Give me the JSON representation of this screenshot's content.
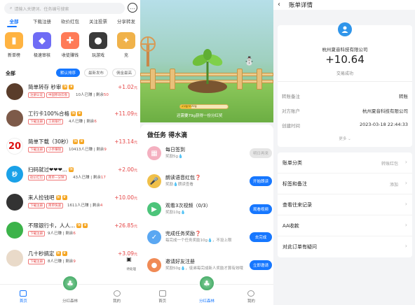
{
  "home": {
    "search_placeholder": "请输入关键词、任务编号搜索",
    "tabs": [
      "全部",
      "下载注册",
      "砍价红包",
      "关注投票",
      "分享转发"
    ],
    "categories": [
      {
        "label": "新单榜",
        "icon": "bars-icon",
        "color": "#ffb341"
      },
      {
        "label": "极速审核",
        "icon": "shield-icon",
        "color": "#6f6cf5"
      },
      {
        "label": "收徒赚钱",
        "icon": "gift-icon",
        "color": "#ff7b57"
      },
      {
        "label": "玩游戏",
        "icon": "gamepad-icon",
        "color": "#3a3a3a"
      },
      {
        "label": "充",
        "icon": "windmill-icon",
        "color": "#f0b24a"
      }
    ],
    "section_title": "全部",
    "sort": [
      "默认排序",
      "最新发布",
      "佣金最高"
    ],
    "tasks": [
      {
        "title": "简单转存 秒审",
        "tags": [
          "注册认证",
          "中国移动云盘"
        ],
        "done": "10人已赚",
        "left": "50",
        "price": "+1.02",
        "avatar_bg": "#5a3d2b",
        "avatar_text": ""
      },
      {
        "title": "工行卡100%合格",
        "tags": [
          "下载注册",
          "工商银行"
        ],
        "done": "4人已赚",
        "left": "6",
        "price": "+11.09",
        "avatar_bg": "#7d5a49",
        "avatar_text": ""
      },
      {
        "title": "简单下载（30秒）",
        "tags": [
          "下载注册",
          "小手赚钱"
        ],
        "done": "10413人已赚",
        "left": "9",
        "price": "+13.14",
        "avatar_bg": "#fff",
        "avatar_text": "20"
      },
      {
        "title": "扫码就过❤❤❤...",
        "tags": [
          "砍价红包",
          "简单一分钟"
        ],
        "done": "43人已赚",
        "left": "17",
        "price": "+2.00",
        "avatar_bg": "#1aa1e8",
        "avatar_text": "秒"
      },
      {
        "title": "来人捡钱吧",
        "tags": [
          "下载注册",
          "简单快速"
        ],
        "done": "1611人已赚",
        "left": "4",
        "price": "+10.00",
        "avatar_bg": "#333",
        "avatar_text": ""
      },
      {
        "title": "不限银行卡，人人...",
        "tags": [
          "下载注册"
        ],
        "done": "9人已赚",
        "left": "6",
        "price": "+26.85",
        "avatar_bg": "#3cb34a",
        "avatar_text": ""
      },
      {
        "title": "几十秒搞定",
        "tags": [
          "下载注册"
        ],
        "done": "8人已赚",
        "left": "9",
        "price": "+3.09",
        "avatar_bg": "#e9dac9",
        "avatar_text": ""
      }
    ],
    "publish_label": "待处理",
    "nav": [
      "首页",
      "分红森林",
      "我的"
    ]
  },
  "garden": {
    "progress_text": "23g/100g",
    "progress_fraction": 0.23,
    "tip": "还需要79g获得一份分红奖",
    "title": "做任务 得水滴",
    "tasks": [
      {
        "name": "每日签到",
        "desc": "奖励5g💧",
        "button": "明日再来",
        "enabled": false,
        "color": "#f4b0c0",
        "icon": "▦"
      },
      {
        "name": "朗读语音红包❓",
        "desc": "奖励💧朗读查看",
        "button": "开始朗读",
        "enabled": true,
        "color": "#f0c04a",
        "icon": "🎤"
      },
      {
        "name": "观看3次视频（0/3）",
        "desc": "奖励10g💧",
        "button": "观看视频",
        "enabled": true,
        "color": "#4cc47a",
        "icon": "▶"
      },
      {
        "name": "完成任务奖励❓",
        "desc": "每完成一个任务奖励10g💧，不设上限",
        "button": "去完成",
        "enabled": true,
        "color": "#5aa7f2",
        "icon": "✓"
      },
      {
        "name": "邀请好友注册",
        "desc": "奖励50g💧，徒弟每完成新人奖励才算有效哦",
        "button": "立即邀请",
        "enabled": true,
        "color": "#f08a55",
        "icon": "●"
      }
    ],
    "nav": [
      "首页",
      "分红森林",
      "我的"
    ]
  },
  "bill": {
    "title": "账单详情",
    "company": "杭州夏音科技有限公司",
    "amount": "+10.64",
    "status": "交易成功",
    "rows": [
      {
        "k": "转账备注",
        "v": "转账"
      },
      {
        "k": "对方账户",
        "v": "杭州夏音科技有限公司"
      },
      {
        "k": "创建时间",
        "v": "2023-03-18 22:44:33"
      }
    ],
    "more": "更多",
    "list": [
      {
        "k": "账单分类",
        "v": "转账红包"
      },
      {
        "k": "标签和备注",
        "v": "添加"
      },
      {
        "k": "查看往来记录",
        "v": ""
      },
      {
        "k": "AA收款",
        "v": ""
      },
      {
        "k": "对此订单有疑问",
        "v": ""
      }
    ]
  }
}
